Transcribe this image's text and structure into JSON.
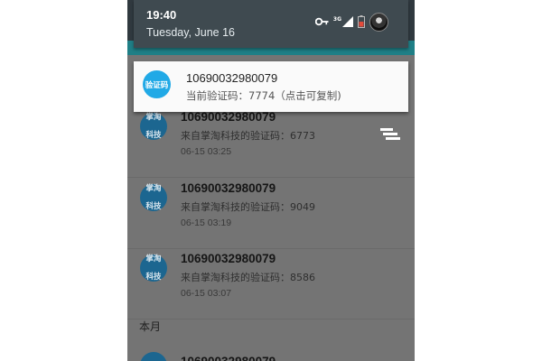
{
  "status_bar": {
    "time": "19:40",
    "date": "Tuesday, June 16",
    "network_label": "3G"
  },
  "heads_up": {
    "badge": "验证码",
    "title": "10690032980079",
    "text": "当前验证码：7774（点击可复制)"
  },
  "messages": [
    {
      "avatar": "掌淘科技",
      "sender": "10690032980079",
      "body": "来自掌淘科技的验证码：6773",
      "time": "06-15 03:25"
    },
    {
      "avatar": "掌淘科技",
      "sender": "10690032980079",
      "body": "来自掌淘科技的验证码：9049",
      "time": "06-15 03:19"
    },
    {
      "avatar": "掌淘科技",
      "sender": "10690032980079",
      "body": "来自掌淘科技的验证码：8586",
      "time": "06-15 03:07"
    }
  ],
  "section": {
    "label": "本月"
  },
  "partial_message": {
    "sender": "10690032980079"
  },
  "colors": {
    "dim_background": "#747474",
    "accent_blue": "#21a9e6",
    "avatar_blue": "#1c6690",
    "shade": "#3f4a50"
  },
  "icons": {
    "key": "key-icon",
    "signal": "signal-icon",
    "battery": "battery-icon",
    "avatar": "avatar-icon",
    "menu": "menu-icon"
  }
}
